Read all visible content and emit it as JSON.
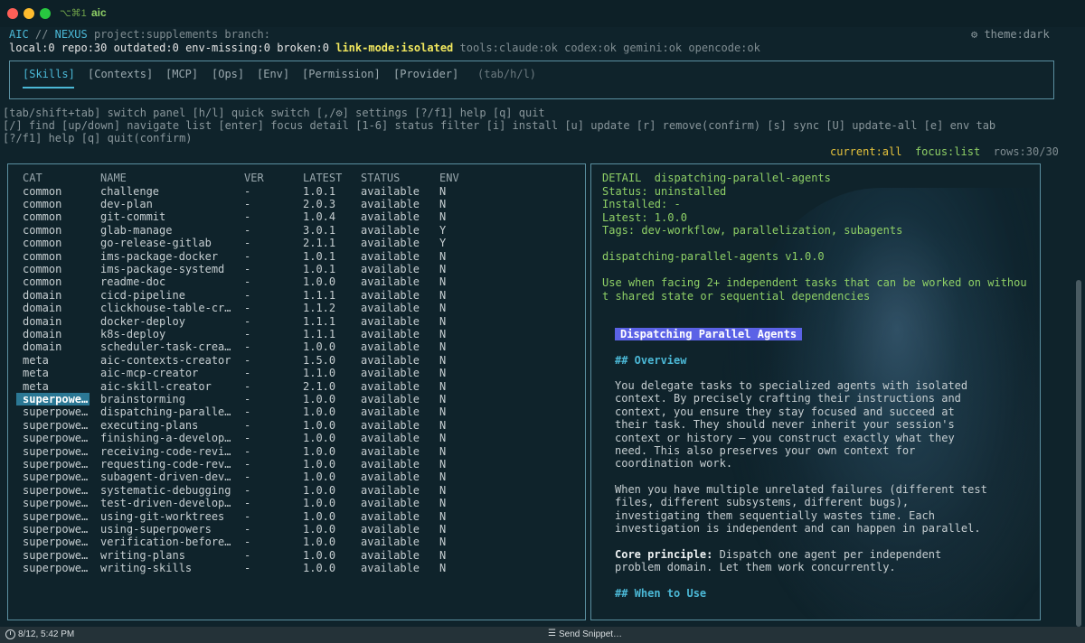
{
  "window": {
    "shortcut": "⌥⌘1",
    "title": "aic"
  },
  "header": {
    "app": "AIC",
    "sep": " // ",
    "nexus": "NEXUS",
    "project": " project:supplements branch:",
    "theme": "theme:dark",
    "theme_icon": "gear-icon",
    "stats": "local:0 repo:30 outdated:0 env-missing:0 broken:0 ",
    "link_mode": "link-mode:isolated",
    "tools": " tools:claude:ok codex:ok gemini:ok opencode:ok"
  },
  "tabs": {
    "items": [
      "[Skills]",
      "[Contexts]",
      "[MCP]",
      "[Ops]",
      "[Env]",
      "[Permission]",
      "[Provider]"
    ],
    "active_index": 0,
    "hint": "(tab/h/l)"
  },
  "help": {
    "line1": "[tab/shift+tab] switch panel [h/l] quick switch [,/⚙] settings [?/f1] help [q] quit",
    "line2": "[/] find [up/down] navigate list [enter] focus detail [1-6] status filter [i] install [u] update [r] remove(confirm) [s] sync [U] update-all [e] env tab",
    "line3": "[?/f1] help [q] quit(confirm)"
  },
  "status_bar": {
    "current": "current:all",
    "focus": "focus:list",
    "rows": "rows:30/30"
  },
  "table": {
    "headers": {
      "cat": "CAT",
      "name": "NAME",
      "ver": "VER",
      "latest": "LATEST",
      "status": "STATUS",
      "env": "ENV"
    },
    "selected_index": 16,
    "rows": [
      {
        "cat": "common",
        "name": "challenge",
        "ver": "-",
        "latest": "1.0.1",
        "status": "available",
        "env": "N"
      },
      {
        "cat": "common",
        "name": "dev-plan",
        "ver": "-",
        "latest": "2.0.3",
        "status": "available",
        "env": "N"
      },
      {
        "cat": "common",
        "name": "git-commit",
        "ver": "-",
        "latest": "1.0.4",
        "status": "available",
        "env": "N"
      },
      {
        "cat": "common",
        "name": "glab-manage",
        "ver": "-",
        "latest": "3.0.1",
        "status": "available",
        "env": "Y"
      },
      {
        "cat": "common",
        "name": "go-release-gitlab",
        "ver": "-",
        "latest": "2.1.1",
        "status": "available",
        "env": "Y"
      },
      {
        "cat": "common",
        "name": "ims-package-docker",
        "ver": "-",
        "latest": "1.0.1",
        "status": "available",
        "env": "N"
      },
      {
        "cat": "common",
        "name": "ims-package-systemd",
        "ver": "-",
        "latest": "1.0.1",
        "status": "available",
        "env": "N"
      },
      {
        "cat": "common",
        "name": "readme-doc",
        "ver": "-",
        "latest": "1.0.0",
        "status": "available",
        "env": "N"
      },
      {
        "cat": "domain",
        "name": "cicd-pipeline",
        "ver": "-",
        "latest": "1.1.1",
        "status": "available",
        "env": "N"
      },
      {
        "cat": "domain",
        "name": "clickhouse-table-cr…",
        "ver": "-",
        "latest": "1.1.2",
        "status": "available",
        "env": "N"
      },
      {
        "cat": "domain",
        "name": "docker-deploy",
        "ver": "-",
        "latest": "1.1.1",
        "status": "available",
        "env": "N"
      },
      {
        "cat": "domain",
        "name": "k8s-deploy",
        "ver": "-",
        "latest": "1.1.1",
        "status": "available",
        "env": "N"
      },
      {
        "cat": "domain",
        "name": "scheduler-task-crea…",
        "ver": "-",
        "latest": "1.0.0",
        "status": "available",
        "env": "N"
      },
      {
        "cat": "meta",
        "name": "aic-contexts-creator",
        "ver": "-",
        "latest": "1.5.0",
        "status": "available",
        "env": "N"
      },
      {
        "cat": "meta",
        "name": "aic-mcp-creator",
        "ver": "-",
        "latest": "1.1.0",
        "status": "available",
        "env": "N"
      },
      {
        "cat": "meta",
        "name": "aic-skill-creator",
        "ver": "-",
        "latest": "2.1.0",
        "status": "available",
        "env": "N"
      },
      {
        "cat": "superpowe…",
        "name": "brainstorming",
        "ver": "-",
        "latest": "1.0.0",
        "status": "available",
        "env": "N"
      },
      {
        "cat": "superpowe…",
        "name": "dispatching-paralle…",
        "ver": "-",
        "latest": "1.0.0",
        "status": "available",
        "env": "N"
      },
      {
        "cat": "superpowe…",
        "name": "executing-plans",
        "ver": "-",
        "latest": "1.0.0",
        "status": "available",
        "env": "N"
      },
      {
        "cat": "superpowe…",
        "name": "finishing-a-develop…",
        "ver": "-",
        "latest": "1.0.0",
        "status": "available",
        "env": "N"
      },
      {
        "cat": "superpowe…",
        "name": "receiving-code-revi…",
        "ver": "-",
        "latest": "1.0.0",
        "status": "available",
        "env": "N"
      },
      {
        "cat": "superpowe…",
        "name": "requesting-code-rev…",
        "ver": "-",
        "latest": "1.0.0",
        "status": "available",
        "env": "N"
      },
      {
        "cat": "superpowe…",
        "name": "subagent-driven-dev…",
        "ver": "-",
        "latest": "1.0.0",
        "status": "available",
        "env": "N"
      },
      {
        "cat": "superpowe…",
        "name": "systematic-debugging",
        "ver": "-",
        "latest": "1.0.0",
        "status": "available",
        "env": "N"
      },
      {
        "cat": "superpowe…",
        "name": "test-driven-develop…",
        "ver": "-",
        "latest": "1.0.0",
        "status": "available",
        "env": "N"
      },
      {
        "cat": "superpowe…",
        "name": "using-git-worktrees",
        "ver": "-",
        "latest": "1.0.0",
        "status": "available",
        "env": "N"
      },
      {
        "cat": "superpowe…",
        "name": "using-superpowers",
        "ver": "-",
        "latest": "1.0.0",
        "status": "available",
        "env": "N"
      },
      {
        "cat": "superpowe…",
        "name": "verification-before…",
        "ver": "-",
        "latest": "1.0.0",
        "status": "available",
        "env": "N"
      },
      {
        "cat": "superpowe…",
        "name": "writing-plans",
        "ver": "-",
        "latest": "1.0.0",
        "status": "available",
        "env": "N"
      },
      {
        "cat": "superpowe…",
        "name": "writing-skills",
        "ver": "-",
        "latest": "1.0.0",
        "status": "available",
        "env": "N"
      }
    ]
  },
  "detail": {
    "lines": [
      "DETAIL  dispatching-parallel-agents",
      "Status: uninstalled",
      "Installed: -",
      "Latest: 1.0.0",
      "Tags: dev-workflow, parallelization, subagents",
      "",
      "dispatching-parallel-agents v1.0.0",
      "",
      "Use when facing 2+ independent tasks that can be worked on withou",
      "t shared state or sequential dependencies"
    ],
    "doc_title": "Dispatching Parallel Agents",
    "h_overview": "## Overview",
    "para1": "You delegate tasks to specialized agents with isolated\ncontext. By precisely crafting their instructions and\ncontext, you ensure they stay focused and succeed at\ntheir task. They should never inherit your session's\ncontext or history — you construct exactly what they\nneed. This also preserves your own context for\ncoordination work.",
    "para2": "When you have multiple unrelated failures (different test\nfiles, different subsystems, different bugs),\ninvestigating them sequentially wastes time. Each\ninvestigation is independent and can happen in parallel.",
    "core_label": "Core principle:",
    "core_text": " Dispatch one agent per independent\nproblem domain. Let them work concurrently.",
    "h_when": "## When to Use"
  },
  "bottom": {
    "timestamp": "8/12, 5:42 PM",
    "snippet_icon": "list-icon",
    "snippet": "Send Snippet…"
  }
}
